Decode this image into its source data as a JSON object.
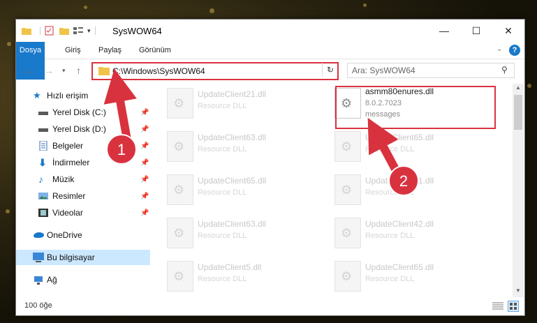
{
  "window": {
    "title": "SysWOW64",
    "buttons": {
      "minimize": "—",
      "maximize": "☐",
      "close": "✕"
    }
  },
  "ribbon": {
    "tabs": [
      "Dosya",
      "Giriş",
      "Paylaş",
      "Görünüm"
    ],
    "help": "?"
  },
  "address": {
    "path": "C:\\Windows\\SysWOW64",
    "search_placeholder": "Ara: SysWOW64"
  },
  "sidebar": {
    "items": [
      {
        "label": "Hızlı erişim",
        "icon": "star-icon"
      },
      {
        "label": "Yerel Disk (C:)",
        "icon": "drive-icon",
        "pinned": true
      },
      {
        "label": "Yerel Disk (D:)",
        "icon": "drive-icon",
        "pinned": true
      },
      {
        "label": "Belgeler",
        "icon": "documents-icon",
        "pinned": true
      },
      {
        "label": "İndirmeler",
        "icon": "download-icon",
        "pinned": true
      },
      {
        "label": "Müzik",
        "icon": "music-icon",
        "pinned": true
      },
      {
        "label": "Resimler",
        "icon": "pictures-icon",
        "pinned": true
      },
      {
        "label": "Videolar",
        "icon": "videos-icon",
        "pinned": true
      },
      {
        "label": "OneDrive",
        "icon": "cloud-icon"
      },
      {
        "label": "Bu bilgisayar",
        "icon": "computer-icon",
        "selected": true
      },
      {
        "label": "Ağ",
        "icon": "network-icon"
      }
    ]
  },
  "files": [
    {
      "name": "UpdateClient21.dll",
      "desc": "Resource DLL"
    },
    {
      "name": "asmm80enures.dll",
      "desc": "8.0.2.7023",
      "desc2": "messages",
      "highlighted": true
    },
    {
      "name": "UpdateClient63.dll",
      "desc": "Resource DLL"
    },
    {
      "name": "UpdateClient65.dll",
      "desc": "Resource DLL"
    },
    {
      "name": "UpdateClient65.dll",
      "desc": "Resource DLL"
    },
    {
      "name": "UpdateClient21.dll",
      "desc": "Resource DLL"
    },
    {
      "name": "UpdateClient63.dll",
      "desc": "Resource DLL"
    },
    {
      "name": "UpdateClient42.dll",
      "desc": "Resource DLL"
    },
    {
      "name": "UpdateClient5.dll",
      "desc": "Resource DLL"
    },
    {
      "name": "UpdateClient65.dll",
      "desc": "Resource DLL"
    }
  ],
  "status": {
    "item_count": "100 öğe"
  },
  "annotations": {
    "badge1": "1",
    "badge2": "2",
    "color": "#d9323f"
  }
}
